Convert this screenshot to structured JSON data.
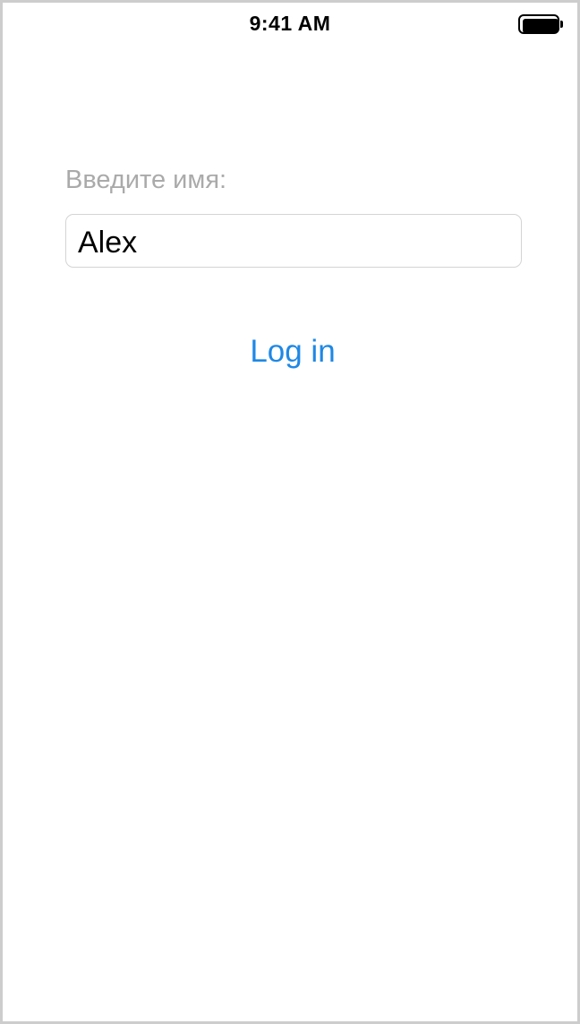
{
  "status_bar": {
    "time": "9:41 AM",
    "battery_icon": "battery-full-icon",
    "battery_level": 1.0
  },
  "form": {
    "prompt_label": "Введите имя:",
    "name_field_value": "Alex"
  },
  "actions": {
    "login_label": "Log in"
  },
  "colors": {
    "accent": "#1e88e5",
    "label_gray": "#aaaaaa",
    "field_border": "#d4d4d4",
    "device_border": "#cdcdcd"
  }
}
